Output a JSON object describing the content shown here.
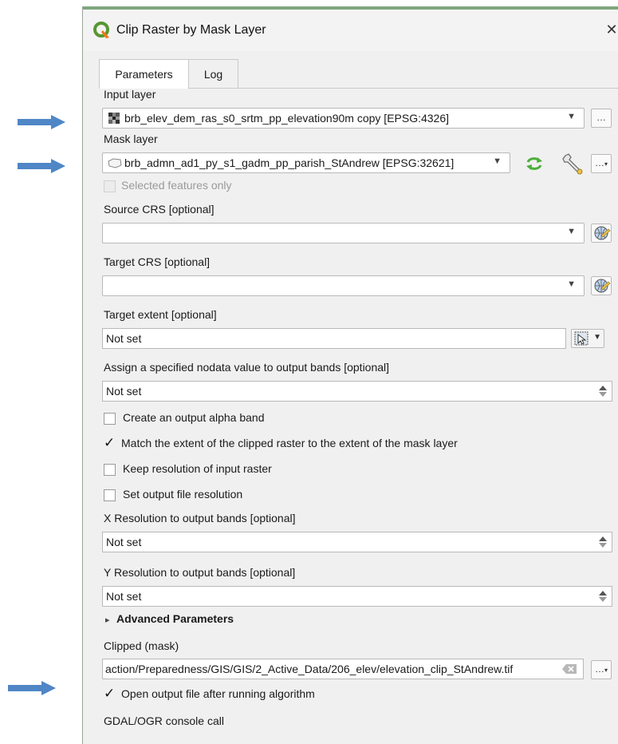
{
  "window": {
    "title": "Clip Raster by Mask Layer",
    "close_symbol": "✕",
    "icon": "qgis-logo-icon"
  },
  "tabs": [
    {
      "label": "Parameters",
      "active": true
    },
    {
      "label": "Log",
      "active": false
    }
  ],
  "colors": {
    "arrow": "#4f86c6",
    "check_mark": "#111111",
    "qgis_green": "#589632"
  },
  "params": {
    "input_layer": {
      "label": "Input layer",
      "value": "brb_elev_dem_ras_s0_srtm_pp_elevation90m copy [EPSG:4326]",
      "browse": "…"
    },
    "mask_layer": {
      "label": "Mask layer",
      "value": "brb_admn_ad1_py_s1_gadm_pp_parish_StAndrew [EPSG:32621]",
      "browse": "…"
    },
    "selected_only": {
      "label": "Selected features only",
      "checked": false,
      "enabled": false
    },
    "source_crs": {
      "label": "Source CRS [optional]",
      "value": ""
    },
    "target_crs": {
      "label": "Target CRS [optional]",
      "value": ""
    },
    "target_extent": {
      "label": "Target extent [optional]",
      "value": "Not set"
    },
    "nodata": {
      "label": "Assign a specified nodata value to output bands [optional]",
      "value": "Not set"
    },
    "alpha_band": {
      "label": "Create an output alpha band",
      "checked": false
    },
    "match_extent": {
      "label": "Match the extent of the clipped raster to the extent of the mask layer",
      "checked": true
    },
    "keep_resolution": {
      "label": "Keep resolution of input raster",
      "checked": false
    },
    "set_resolution": {
      "label": "Set output file resolution",
      "checked": false
    },
    "x_res": {
      "label": "X Resolution to output bands [optional]",
      "value": "Not set"
    },
    "y_res": {
      "label": "Y Resolution to output bands [optional]",
      "value": "Not set"
    },
    "advanced": {
      "label": "Advanced Parameters",
      "expander": "▸"
    },
    "clipped": {
      "label": "Clipped (mask)",
      "value": "action/Preparedness/GIS/GIS/2_Active_Data/206_elev/elevation_clip_StAndrew.tif",
      "browse": "…"
    },
    "open_output": {
      "label": "Open output file after running algorithm",
      "checked": true
    },
    "gdal_console": {
      "label": "GDAL/OGR console call"
    }
  },
  "check_mark": "✓"
}
